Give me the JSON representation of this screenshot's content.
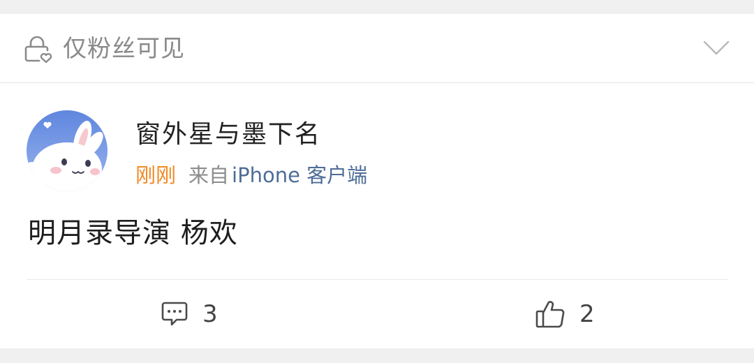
{
  "visibility": {
    "label": "仅粉丝可见",
    "icon": "lock-heart-icon",
    "toggle_icon": "chevron-down-icon"
  },
  "author": {
    "name": "窗外星与墨下名",
    "avatar_icon": "bunny-avatar",
    "time": "刚刚",
    "from_label": "来自",
    "source": "iPhone 客户端"
  },
  "post": {
    "text": "明月录导演 杨欢"
  },
  "actions": {
    "comment": {
      "icon": "comment-icon",
      "count": "3"
    },
    "like": {
      "icon": "thumbs-up-icon",
      "count": "2"
    }
  },
  "colors": {
    "time": "#f08a24",
    "source_link": "#4e6d96",
    "muted": "#8a8a8a",
    "avatar_bg": "#6f8fe0"
  }
}
